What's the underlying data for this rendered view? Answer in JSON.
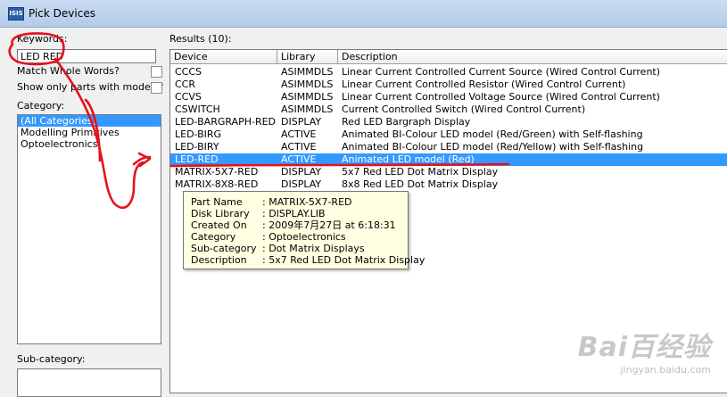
{
  "window": {
    "title": "Pick Devices",
    "app_icon_text": "ISIS"
  },
  "left": {
    "keywords_label": "Keywords:",
    "keywords_value": "LED RED",
    "match_whole_words_label": "Match Whole Words?",
    "show_only_parts_label": "Show only parts with models?",
    "category_label": "Category:",
    "categories": [
      "(All Categories)",
      "Modelling Primitives",
      "Optoelectronics"
    ],
    "subcategory_label": "Sub-category:"
  },
  "results": {
    "label": "Results (10):",
    "columns": [
      "Device",
      "Library",
      "Description"
    ],
    "rows": [
      {
        "device": "CCCS",
        "library": "ASIMMDLS",
        "description": "Linear Current Controlled Current Source (Wired Control Current)"
      },
      {
        "device": "CCR",
        "library": "ASIMMDLS",
        "description": "Linear Current Controlled Resistor (Wired Control Current)"
      },
      {
        "device": "CCVS",
        "library": "ASIMMDLS",
        "description": "Linear Current Controlled Voltage Source (Wired Control Current)"
      },
      {
        "device": "CSWITCH",
        "library": "ASIMMDLS",
        "description": "Current Controlled Switch (Wired Control Current)"
      },
      {
        "device": "LED-BARGRAPH-RED",
        "library": "DISPLAY",
        "description": "Red LED Bargraph Display"
      },
      {
        "device": "LED-BIRG",
        "library": "ACTIVE",
        "description": "Animated BI-Colour LED model (Red/Green) with Self-flashing"
      },
      {
        "device": "LED-BIRY",
        "library": "ACTIVE",
        "description": "Animated BI-Colour LED model (Red/Yellow) with Self-flashing"
      },
      {
        "device": "LED-RED",
        "library": "ACTIVE",
        "description": "Animated LED model (Red)"
      },
      {
        "device": "MATRIX-5X7-RED",
        "library": "DISPLAY",
        "description": "5x7 Red LED Dot Matrix Display"
      },
      {
        "device": "MATRIX-8X8-RED",
        "library": "DISPLAY",
        "description": "8x8 Red LED Dot Matrix Display"
      }
    ]
  },
  "tooltip": {
    "rows": [
      {
        "key": "Part Name",
        "value": ": MATRIX-5X7-RED"
      },
      {
        "key": "Disk Library",
        "value": ": DISPLAY.LIB"
      },
      {
        "key": "Created On",
        "value": ": 2009年7月27日  at 6:18:31"
      },
      {
        "key": "Category",
        "value": ": Optoelectronics"
      },
      {
        "key": "Sub-category",
        "value": ": Dot Matrix Displays"
      },
      {
        "key": "Description",
        "value": ": 5x7 Red LED Dot Matrix Display"
      }
    ]
  },
  "watermark": {
    "brand": "Bai百经验",
    "url": "jingyan.baidu.com"
  },
  "colors": {
    "selection": "#3399ff",
    "annotation": "#e8101a",
    "tooltip_bg": "#ffffe1"
  }
}
